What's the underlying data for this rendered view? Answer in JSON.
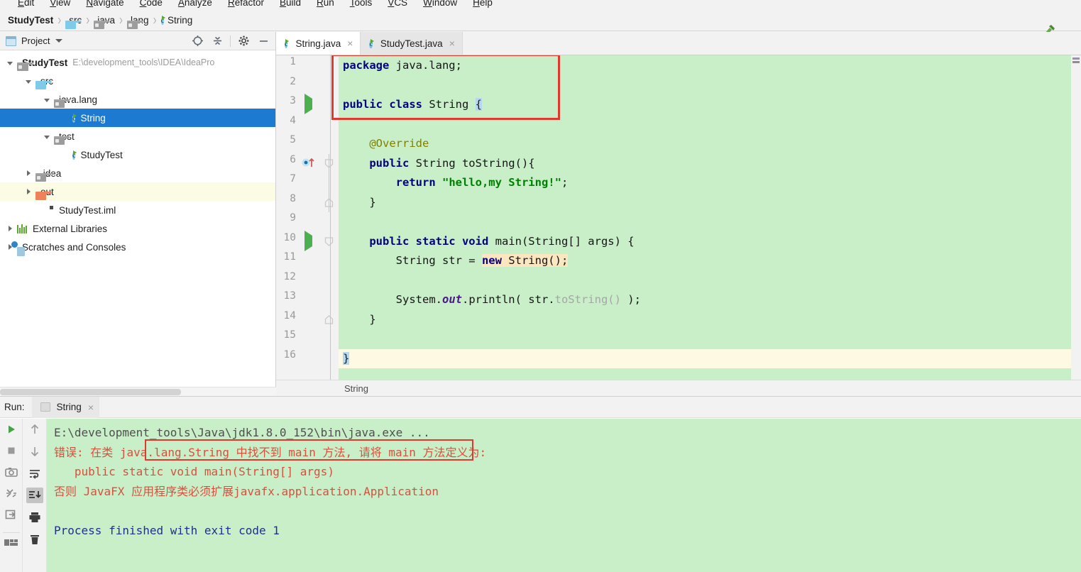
{
  "menubar": {
    "items": [
      "Edit",
      "View",
      "Navigate",
      "Code",
      "Analyze",
      "Refactor",
      "Build",
      "Run",
      "Tools",
      "VCS",
      "Window",
      "Help"
    ]
  },
  "navbar": {
    "crumbs": [
      {
        "label": "StudyTest",
        "icon": "project-icon"
      },
      {
        "label": "src",
        "icon": "folder-blue-icon"
      },
      {
        "label": "java",
        "icon": "folder-gray-icon"
      },
      {
        "label": "lang",
        "icon": "folder-gray-icon"
      },
      {
        "label": "String",
        "icon": "java-class-icon"
      }
    ],
    "separator": "›",
    "build_icon": "hammer-icon"
  },
  "project_panel": {
    "title": "Project",
    "toolbar": [
      "locate-icon",
      "collapse-all-icon",
      "settings-gear-icon",
      "minimize-icon"
    ],
    "tree": [
      {
        "label": "StudyTest",
        "path": "E:\\development_tools\\IDEA\\IdeaPro",
        "icon": "module-icon",
        "twisty": "down",
        "indent": 0,
        "bold": true,
        "state": "normal"
      },
      {
        "label": "src",
        "path": "",
        "icon": "folder-blue-icon",
        "twisty": "down",
        "indent": 1,
        "bold": false,
        "state": "normal"
      },
      {
        "label": "java.lang",
        "path": "",
        "icon": "folder-gray-icon",
        "twisty": "down",
        "indent": 2,
        "bold": false,
        "state": "normal"
      },
      {
        "label": "String",
        "path": "",
        "icon": "java-class-icon",
        "twisty": "none",
        "indent": 3,
        "bold": false,
        "state": "selected"
      },
      {
        "label": "test",
        "path": "",
        "icon": "folder-gray-icon",
        "twisty": "down",
        "indent": 2,
        "bold": false,
        "state": "normal"
      },
      {
        "label": "StudyTest",
        "path": "",
        "icon": "java-class-icon",
        "twisty": "none",
        "indent": 3,
        "bold": false,
        "state": "normal"
      },
      {
        "label": ".idea",
        "path": "",
        "icon": "folder-gray-icon",
        "twisty": "right",
        "indent": 1,
        "bold": false,
        "state": "normal"
      },
      {
        "label": "out",
        "path": "",
        "icon": "folder-orange-icon",
        "twisty": "right",
        "indent": 1,
        "bold": false,
        "state": "highlight"
      },
      {
        "label": "StudyTest.iml",
        "path": "",
        "icon": "iml-file-icon",
        "twisty": "none",
        "indent": 2,
        "bold": false,
        "state": "normal"
      },
      {
        "label": "External Libraries",
        "path": "",
        "icon": "libraries-icon",
        "twisty": "right",
        "indent": 0,
        "bold": false,
        "state": "normal"
      },
      {
        "label": "Scratches and Consoles",
        "path": "",
        "icon": "scratches-icon",
        "twisty": "right",
        "indent": 0,
        "bold": false,
        "state": "normal"
      }
    ]
  },
  "editor": {
    "tabs": [
      {
        "label": "String.java",
        "active": true,
        "close": "×"
      },
      {
        "label": "StudyTest.java",
        "active": false,
        "close": "×"
      }
    ],
    "breadcrumb": "String",
    "line_count": 16,
    "lines": [
      {
        "n": "1",
        "run": false,
        "segs": [
          {
            "t": "package ",
            "c": "kw"
          },
          {
            "t": "java.lang;",
            "c": "plain"
          }
        ]
      },
      {
        "n": "2",
        "run": false,
        "segs": []
      },
      {
        "n": "3",
        "run": true,
        "segs": [
          {
            "t": "public class ",
            "c": "kw"
          },
          {
            "t": "String ",
            "c": "plain"
          },
          {
            "t": "{",
            "c": "caret-brace"
          }
        ]
      },
      {
        "n": "4",
        "run": false,
        "segs": []
      },
      {
        "n": "5",
        "run": false,
        "segs": [
          {
            "t": "    @Override",
            "c": "anno"
          }
        ]
      },
      {
        "n": "6",
        "run": false,
        "override": true,
        "segs": [
          {
            "t": "    public ",
            "c": "kw"
          },
          {
            "t": "String toString(){",
            "c": "plain"
          }
        ]
      },
      {
        "n": "7",
        "run": false,
        "segs": [
          {
            "t": "        return ",
            "c": "kw"
          },
          {
            "t": "\"hello,my String!\"",
            "c": "str"
          },
          {
            "t": ";",
            "c": "plain"
          }
        ]
      },
      {
        "n": "8",
        "run": false,
        "segs": [
          {
            "t": "    }",
            "c": "plain"
          }
        ]
      },
      {
        "n": "9",
        "run": false,
        "segs": []
      },
      {
        "n": "10",
        "run": true,
        "segs": [
          {
            "t": "    public static void ",
            "c": "kw"
          },
          {
            "t": "main(String[] args) {",
            "c": "plain"
          }
        ]
      },
      {
        "n": "11",
        "run": false,
        "segs": [
          {
            "t": "        String str = ",
            "c": "plain"
          },
          {
            "t": "new ",
            "c": "kw hl-new"
          },
          {
            "t": "String();",
            "c": "plain hl-new"
          }
        ]
      },
      {
        "n": "12",
        "run": false,
        "segs": []
      },
      {
        "n": "13",
        "run": false,
        "segs": [
          {
            "t": "        System.",
            "c": "plain"
          },
          {
            "t": "out",
            "c": "ital"
          },
          {
            "t": ".println( str.",
            "c": "plain"
          },
          {
            "t": "toString()",
            "c": "gray"
          },
          {
            "t": " );",
            "c": "plain"
          }
        ]
      },
      {
        "n": "14",
        "run": false,
        "segs": [
          {
            "t": "    }",
            "c": "plain"
          }
        ]
      },
      {
        "n": "15",
        "run": false,
        "segs": []
      },
      {
        "n": "16",
        "run": false,
        "last": true,
        "segs": [
          {
            "t": "}",
            "c": "caret-brace"
          }
        ]
      }
    ]
  },
  "run_panel": {
    "label": "Run:",
    "tab_label": "String",
    "tab_close": "×",
    "toolbar_left": [
      "rerun-icon",
      "stop-icon",
      "camera-icon",
      "thread-dump-icon",
      "export-icon",
      "layout-icon"
    ],
    "toolbar_right": [
      "scroll-up-icon",
      "scroll-down-icon",
      "soft-wrap-icon",
      "scroll-to-end-icon",
      "print-icon",
      "trash-icon"
    ],
    "console": [
      {
        "color": "c-gray",
        "text": "E:\\development_tools\\Java\\jdk1.8.0_152\\bin\\java.exe ..."
      },
      {
        "color": "c-red",
        "text": "错误: 在类 java.lang.String 中找不到 main 方法, 请将 main 方法定义为:"
      },
      {
        "color": "c-red",
        "text": "   public static void main(String[] args)"
      },
      {
        "color": "c-red",
        "text": "否则 JavaFX 应用程序类必须扩展javafx.application.Application"
      },
      {
        "color": "c-red",
        "text": ""
      },
      {
        "color": "c-navy",
        "text": "Process finished with exit code 1"
      }
    ]
  },
  "colors": {
    "editor_bg": "#c9efc9",
    "console_bg": "#c9efc9",
    "selection_blue": "#1d7ad1",
    "annotation_box": "#e03a30",
    "keyword": "#000080",
    "string": "#008000",
    "error_red": "#d94f3d",
    "exit_navy": "#1f2f8f",
    "highlight_yellow": "#fcfbe3"
  }
}
